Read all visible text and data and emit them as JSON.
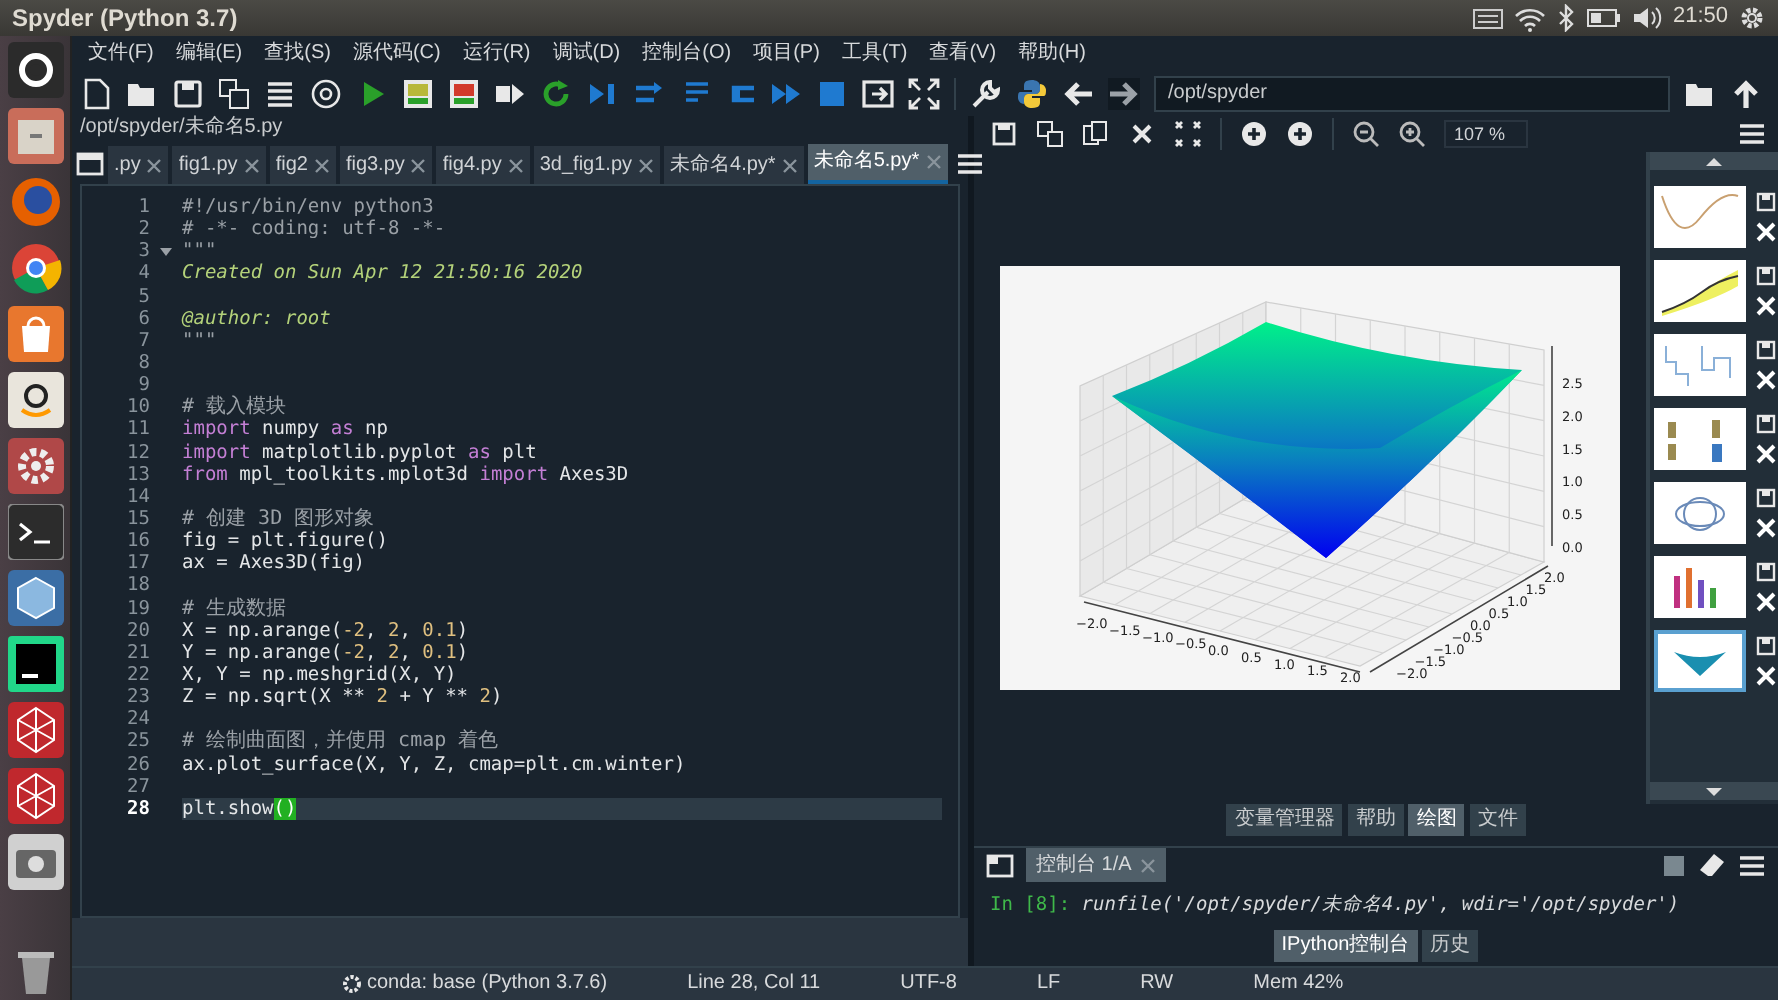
{
  "window": {
    "title": "Spyder (Python 3.7)",
    "clock": "21:50"
  },
  "menu": [
    "文件(F)",
    "编辑(E)",
    "查找(S)",
    "源代码(C)",
    "运行(R)",
    "调试(D)",
    "控制台(O)",
    "项目(P)",
    "工具(T)",
    "查看(V)",
    "帮助(H)"
  ],
  "working_directory": "/opt/spyder",
  "editor": {
    "path": "/opt/spyder/未命名5.py",
    "tabs": [
      {
        "label": ".py",
        "selected": false
      },
      {
        "label": "fig1.py",
        "selected": false
      },
      {
        "label": "fig2",
        "selected": false
      },
      {
        "label": "fig3.py",
        "selected": false
      },
      {
        "label": "fig4.py",
        "selected": false
      },
      {
        "label": "3d_fig1.py",
        "selected": false
      },
      {
        "label": "未命名4.py*",
        "selected": false
      },
      {
        "label": "未命名5.py*",
        "selected": true
      }
    ],
    "lines": [
      {
        "number": "1",
        "current": false,
        "fold": false,
        "tokens": [
          {
            "text": "#!/usr/bin/env python3",
            "kind": "comment"
          }
        ]
      },
      {
        "number": "2",
        "current": false,
        "fold": false,
        "tokens": [
          {
            "text": "# -*- coding: utf-8 -*-",
            "kind": "comment"
          }
        ]
      },
      {
        "number": "3",
        "current": false,
        "fold": true,
        "tokens": [
          {
            "text": "\"\"\"",
            "kind": "comment"
          }
        ]
      },
      {
        "number": "4",
        "current": false,
        "fold": false,
        "tokens": [
          {
            "text": "Created on Sun Apr 12 21:50:16 2020",
            "kind": "docstring"
          }
        ]
      },
      {
        "number": "5",
        "current": false,
        "fold": false
      },
      {
        "number": "6",
        "current": false,
        "fold": false,
        "tokens": [
          {
            "text": "@author: root",
            "kind": "docstring"
          }
        ]
      },
      {
        "number": "7",
        "current": false,
        "fold": false,
        "tokens": [
          {
            "text": "\"\"\"",
            "kind": "comment"
          }
        ]
      },
      {
        "number": "8",
        "current": false,
        "fold": false
      },
      {
        "number": "9",
        "current": false,
        "fold": false
      },
      {
        "number": "10",
        "current": false,
        "fold": false,
        "tokens": [
          {
            "text": "# 载入模块",
            "kind": "comment"
          }
        ]
      },
      {
        "number": "11",
        "current": false,
        "fold": false,
        "tokens": [
          {
            "text": "import",
            "kind": "keyword"
          },
          {
            "text": " numpy ",
            "kind": "plain"
          },
          {
            "text": "as",
            "kind": "keyword"
          },
          {
            "text": " np",
            "kind": "plain"
          }
        ]
      },
      {
        "number": "12",
        "current": false,
        "fold": false,
        "tokens": [
          {
            "text": "import",
            "kind": "keyword"
          },
          {
            "text": " matplotlib.pyplot ",
            "kind": "plain"
          },
          {
            "text": "as",
            "kind": "keyword"
          },
          {
            "text": " plt",
            "kind": "plain"
          }
        ]
      },
      {
        "number": "13",
        "current": false,
        "fold": false,
        "tokens": [
          {
            "text": "from",
            "kind": "keyword"
          },
          {
            "text": " mpl_toolkits.mplot3d ",
            "kind": "plain"
          },
          {
            "text": "import",
            "kind": "keyword"
          },
          {
            "text": " Axes3D",
            "kind": "plain"
          }
        ]
      },
      {
        "number": "14",
        "current": false,
        "fold": false
      },
      {
        "number": "15",
        "current": false,
        "fold": false,
        "tokens": [
          {
            "text": "# 创建 3D 图形对象",
            "kind": "comment"
          }
        ]
      },
      {
        "number": "16",
        "current": false,
        "fold": false,
        "tokens": [
          {
            "text": "fig = plt.figure()",
            "kind": "plain"
          }
        ]
      },
      {
        "number": "17",
        "current": false,
        "fold": false,
        "tokens": [
          {
            "text": "ax = Axes3D(fig)",
            "kind": "plain"
          }
        ]
      },
      {
        "number": "18",
        "current": false,
        "fold": false
      },
      {
        "number": "19",
        "current": false,
        "fold": false,
        "tokens": [
          {
            "text": "# 生成数据",
            "kind": "comment"
          }
        ]
      },
      {
        "number": "20",
        "current": false,
        "fold": false,
        "tokens": [
          {
            "text": "X = np.arange(",
            "kind": "plain"
          },
          {
            "text": "-2",
            "kind": "number"
          },
          {
            "text": ", ",
            "kind": "plain"
          },
          {
            "text": "2",
            "kind": "number"
          },
          {
            "text": ", ",
            "kind": "plain"
          },
          {
            "text": "0.1",
            "kind": "number"
          },
          {
            "text": ")",
            "kind": "plain"
          }
        ]
      },
      {
        "number": "21",
        "current": false,
        "fold": false,
        "tokens": [
          {
            "text": "Y = np.arange(",
            "kind": "plain"
          },
          {
            "text": "-2",
            "kind": "number"
          },
          {
            "text": ", ",
            "kind": "plain"
          },
          {
            "text": "2",
            "kind": "number"
          },
          {
            "text": ", ",
            "kind": "plain"
          },
          {
            "text": "0.1",
            "kind": "number"
          },
          {
            "text": ")",
            "kind": "plain"
          }
        ]
      },
      {
        "number": "22",
        "current": false,
        "fold": false,
        "tokens": [
          {
            "text": "X, Y = np.meshgrid(X, Y)",
            "kind": "plain"
          }
        ]
      },
      {
        "number": "23",
        "current": false,
        "fold": false,
        "tokens": [
          {
            "text": "Z = np.sqrt(X ** ",
            "kind": "plain"
          },
          {
            "text": "2",
            "kind": "number"
          },
          {
            "text": " + Y ** ",
            "kind": "plain"
          },
          {
            "text": "2",
            "kind": "number"
          },
          {
            "text": ")",
            "kind": "plain"
          }
        ]
      },
      {
        "number": "24",
        "current": false,
        "fold": false
      },
      {
        "number": "25",
        "current": false,
        "fold": false,
        "tokens": [
          {
            "text": "# 绘制曲面图，并使用 cmap 着色",
            "kind": "comment"
          }
        ]
      },
      {
        "number": "26",
        "current": false,
        "fold": false,
        "tokens": [
          {
            "text": "ax.plot_surface(X, Y, Z, cmap=plt.cm.winter)",
            "kind": "plain"
          }
        ]
      },
      {
        "number": "27",
        "current": false,
        "fold": false
      },
      {
        "number": "28",
        "current": true,
        "fold": false,
        "tokens": [
          {
            "text": "plt.show",
            "kind": "plain"
          },
          {
            "text": "()",
            "kind": "match"
          }
        ]
      }
    ]
  },
  "plots": {
    "zoom": "107 %",
    "figure": {
      "x_ticks": [
        "−2.0",
        "−1.5",
        "−1.0",
        "−0.5",
        "0.0",
        "0.5",
        "1.0",
        "1.5",
        "2.0"
      ],
      "y_ticks": [
        "−2.0",
        "−1.5",
        "−1.0",
        "−0.5",
        "0.0",
        "0.5",
        "1.0",
        "1.5",
        "2.0"
      ],
      "z_ticks": [
        "2.5",
        "2.0",
        "1.5",
        "1.0",
        "0.5",
        "0.0"
      ]
    },
    "thumbnails": [
      {
        "selected": false
      },
      {
        "selected": false
      },
      {
        "selected": false
      },
      {
        "selected": false
      },
      {
        "selected": false
      },
      {
        "selected": false
      },
      {
        "selected": true
      }
    ]
  },
  "pane_tabs": [
    {
      "label": "变量管理器",
      "selected": false
    },
    {
      "label": "帮助",
      "selected": false
    },
    {
      "label": "绘图",
      "selected": true
    },
    {
      "label": "文件",
      "selected": false
    }
  ],
  "console": {
    "tab": "控制台 1/A",
    "prompt": "In [8]:",
    "input": "runfile('/opt/spyder/未命名4.py', wdir='/opt/spyder')",
    "tabs": [
      {
        "label": "IPython控制台",
        "selected": true
      },
      {
        "label": "历史",
        "selected": false
      }
    ]
  },
  "status_bar": [
    "conda: base (Python 3.7.6)",
    "Line 28, Col 11",
    "UTF-8",
    "LF",
    "RW",
    "Mem 42%"
  ]
}
